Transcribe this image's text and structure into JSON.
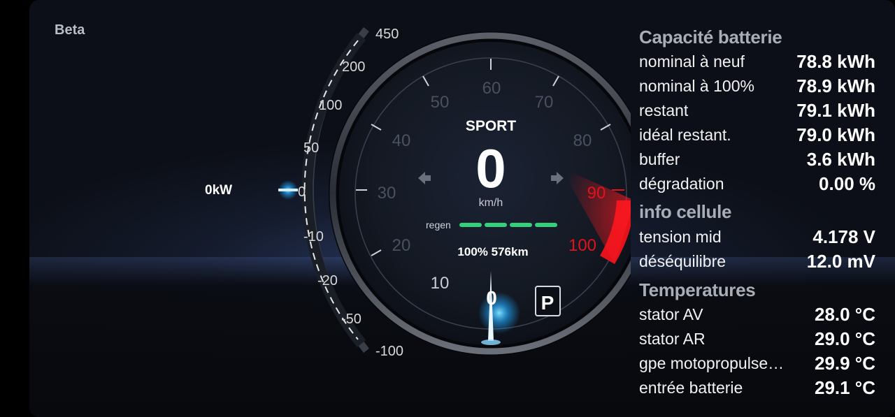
{
  "app": {
    "beta_label": "Beta"
  },
  "power": {
    "current_label": "0kW",
    "ticks": [
      "450",
      "200",
      "100",
      "50",
      "0",
      "-10",
      "-20",
      "-50",
      "-100"
    ]
  },
  "speedo": {
    "mode": "SPORT",
    "speed": "0",
    "unit": "km/h",
    "ticks": [
      "10",
      "20",
      "30",
      "40",
      "50",
      "60",
      "70",
      "80",
      "90",
      "100"
    ],
    "regen_label": "regen",
    "battery_range": "100% 576km",
    "gear_current": "0",
    "gear_mode": "P"
  },
  "battery_capacity": {
    "title": "Capacité batterie",
    "rows": [
      {
        "label": "nominal à neuf",
        "value": "78.8 kWh"
      },
      {
        "label": "nominal à 100%",
        "value": "78.9 kWh"
      },
      {
        "label": "restant",
        "value": "79.1 kWh"
      },
      {
        "label": "idéal restant.",
        "value": "79.0 kWh"
      },
      {
        "label": "buffer",
        "value": "3.6 kWh"
      },
      {
        "label": "dégradation",
        "value": "0.00 %"
      }
    ]
  },
  "cell_info": {
    "title": "info cellule",
    "rows": [
      {
        "label": "tension mid",
        "value": "4.178 V"
      },
      {
        "label": "déséquilibre",
        "value": "12.0 mV"
      }
    ]
  },
  "temperatures": {
    "title": "Temperatures",
    "rows": [
      {
        "label": "stator AV",
        "value": "28.0 °C"
      },
      {
        "label": "stator AR",
        "value": "29.0 °C"
      },
      {
        "label": "gpe motopropulse…",
        "value": "29.9 °C"
      },
      {
        "label": "entrée batterie",
        "value": "29.1 °C"
      }
    ]
  },
  "colors": {
    "accent_red": "#e3121b",
    "regen_green": "#33d17a",
    "glow_blue": "#3fc3ff"
  }
}
